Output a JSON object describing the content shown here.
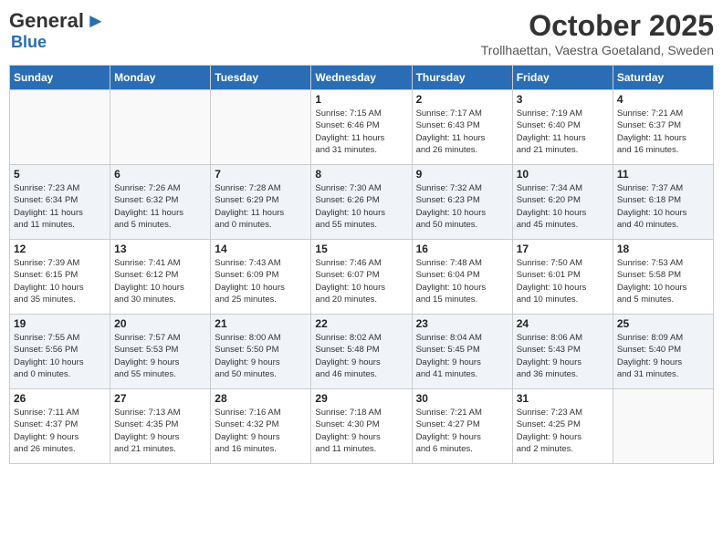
{
  "header": {
    "logo_general": "General",
    "logo_blue": "Blue",
    "title": "October 2025",
    "subtitle": "Trollhaettan, Vaestra Goetaland, Sweden"
  },
  "days_of_week": [
    "Sunday",
    "Monday",
    "Tuesday",
    "Wednesday",
    "Thursday",
    "Friday",
    "Saturday"
  ],
  "weeks": [
    [
      {
        "num": "",
        "info": ""
      },
      {
        "num": "",
        "info": ""
      },
      {
        "num": "",
        "info": ""
      },
      {
        "num": "1",
        "info": "Sunrise: 7:15 AM\nSunset: 6:46 PM\nDaylight: 11 hours\nand 31 minutes."
      },
      {
        "num": "2",
        "info": "Sunrise: 7:17 AM\nSunset: 6:43 PM\nDaylight: 11 hours\nand 26 minutes."
      },
      {
        "num": "3",
        "info": "Sunrise: 7:19 AM\nSunset: 6:40 PM\nDaylight: 11 hours\nand 21 minutes."
      },
      {
        "num": "4",
        "info": "Sunrise: 7:21 AM\nSunset: 6:37 PM\nDaylight: 11 hours\nand 16 minutes."
      }
    ],
    [
      {
        "num": "5",
        "info": "Sunrise: 7:23 AM\nSunset: 6:34 PM\nDaylight: 11 hours\nand 11 minutes."
      },
      {
        "num": "6",
        "info": "Sunrise: 7:26 AM\nSunset: 6:32 PM\nDaylight: 11 hours\nand 5 minutes."
      },
      {
        "num": "7",
        "info": "Sunrise: 7:28 AM\nSunset: 6:29 PM\nDaylight: 11 hours\nand 0 minutes."
      },
      {
        "num": "8",
        "info": "Sunrise: 7:30 AM\nSunset: 6:26 PM\nDaylight: 10 hours\nand 55 minutes."
      },
      {
        "num": "9",
        "info": "Sunrise: 7:32 AM\nSunset: 6:23 PM\nDaylight: 10 hours\nand 50 minutes."
      },
      {
        "num": "10",
        "info": "Sunrise: 7:34 AM\nSunset: 6:20 PM\nDaylight: 10 hours\nand 45 minutes."
      },
      {
        "num": "11",
        "info": "Sunrise: 7:37 AM\nSunset: 6:18 PM\nDaylight: 10 hours\nand 40 minutes."
      }
    ],
    [
      {
        "num": "12",
        "info": "Sunrise: 7:39 AM\nSunset: 6:15 PM\nDaylight: 10 hours\nand 35 minutes."
      },
      {
        "num": "13",
        "info": "Sunrise: 7:41 AM\nSunset: 6:12 PM\nDaylight: 10 hours\nand 30 minutes."
      },
      {
        "num": "14",
        "info": "Sunrise: 7:43 AM\nSunset: 6:09 PM\nDaylight: 10 hours\nand 25 minutes."
      },
      {
        "num": "15",
        "info": "Sunrise: 7:46 AM\nSunset: 6:07 PM\nDaylight: 10 hours\nand 20 minutes."
      },
      {
        "num": "16",
        "info": "Sunrise: 7:48 AM\nSunset: 6:04 PM\nDaylight: 10 hours\nand 15 minutes."
      },
      {
        "num": "17",
        "info": "Sunrise: 7:50 AM\nSunset: 6:01 PM\nDaylight: 10 hours\nand 10 minutes."
      },
      {
        "num": "18",
        "info": "Sunrise: 7:53 AM\nSunset: 5:58 PM\nDaylight: 10 hours\nand 5 minutes."
      }
    ],
    [
      {
        "num": "19",
        "info": "Sunrise: 7:55 AM\nSunset: 5:56 PM\nDaylight: 10 hours\nand 0 minutes."
      },
      {
        "num": "20",
        "info": "Sunrise: 7:57 AM\nSunset: 5:53 PM\nDaylight: 9 hours\nand 55 minutes."
      },
      {
        "num": "21",
        "info": "Sunrise: 8:00 AM\nSunset: 5:50 PM\nDaylight: 9 hours\nand 50 minutes."
      },
      {
        "num": "22",
        "info": "Sunrise: 8:02 AM\nSunset: 5:48 PM\nDaylight: 9 hours\nand 46 minutes."
      },
      {
        "num": "23",
        "info": "Sunrise: 8:04 AM\nSunset: 5:45 PM\nDaylight: 9 hours\nand 41 minutes."
      },
      {
        "num": "24",
        "info": "Sunrise: 8:06 AM\nSunset: 5:43 PM\nDaylight: 9 hours\nand 36 minutes."
      },
      {
        "num": "25",
        "info": "Sunrise: 8:09 AM\nSunset: 5:40 PM\nDaylight: 9 hours\nand 31 minutes."
      }
    ],
    [
      {
        "num": "26",
        "info": "Sunrise: 7:11 AM\nSunset: 4:37 PM\nDaylight: 9 hours\nand 26 minutes."
      },
      {
        "num": "27",
        "info": "Sunrise: 7:13 AM\nSunset: 4:35 PM\nDaylight: 9 hours\nand 21 minutes."
      },
      {
        "num": "28",
        "info": "Sunrise: 7:16 AM\nSunset: 4:32 PM\nDaylight: 9 hours\nand 16 minutes."
      },
      {
        "num": "29",
        "info": "Sunrise: 7:18 AM\nSunset: 4:30 PM\nDaylight: 9 hours\nand 11 minutes."
      },
      {
        "num": "30",
        "info": "Sunrise: 7:21 AM\nSunset: 4:27 PM\nDaylight: 9 hours\nand 6 minutes."
      },
      {
        "num": "31",
        "info": "Sunrise: 7:23 AM\nSunset: 4:25 PM\nDaylight: 9 hours\nand 2 minutes."
      },
      {
        "num": "",
        "info": ""
      }
    ]
  ]
}
